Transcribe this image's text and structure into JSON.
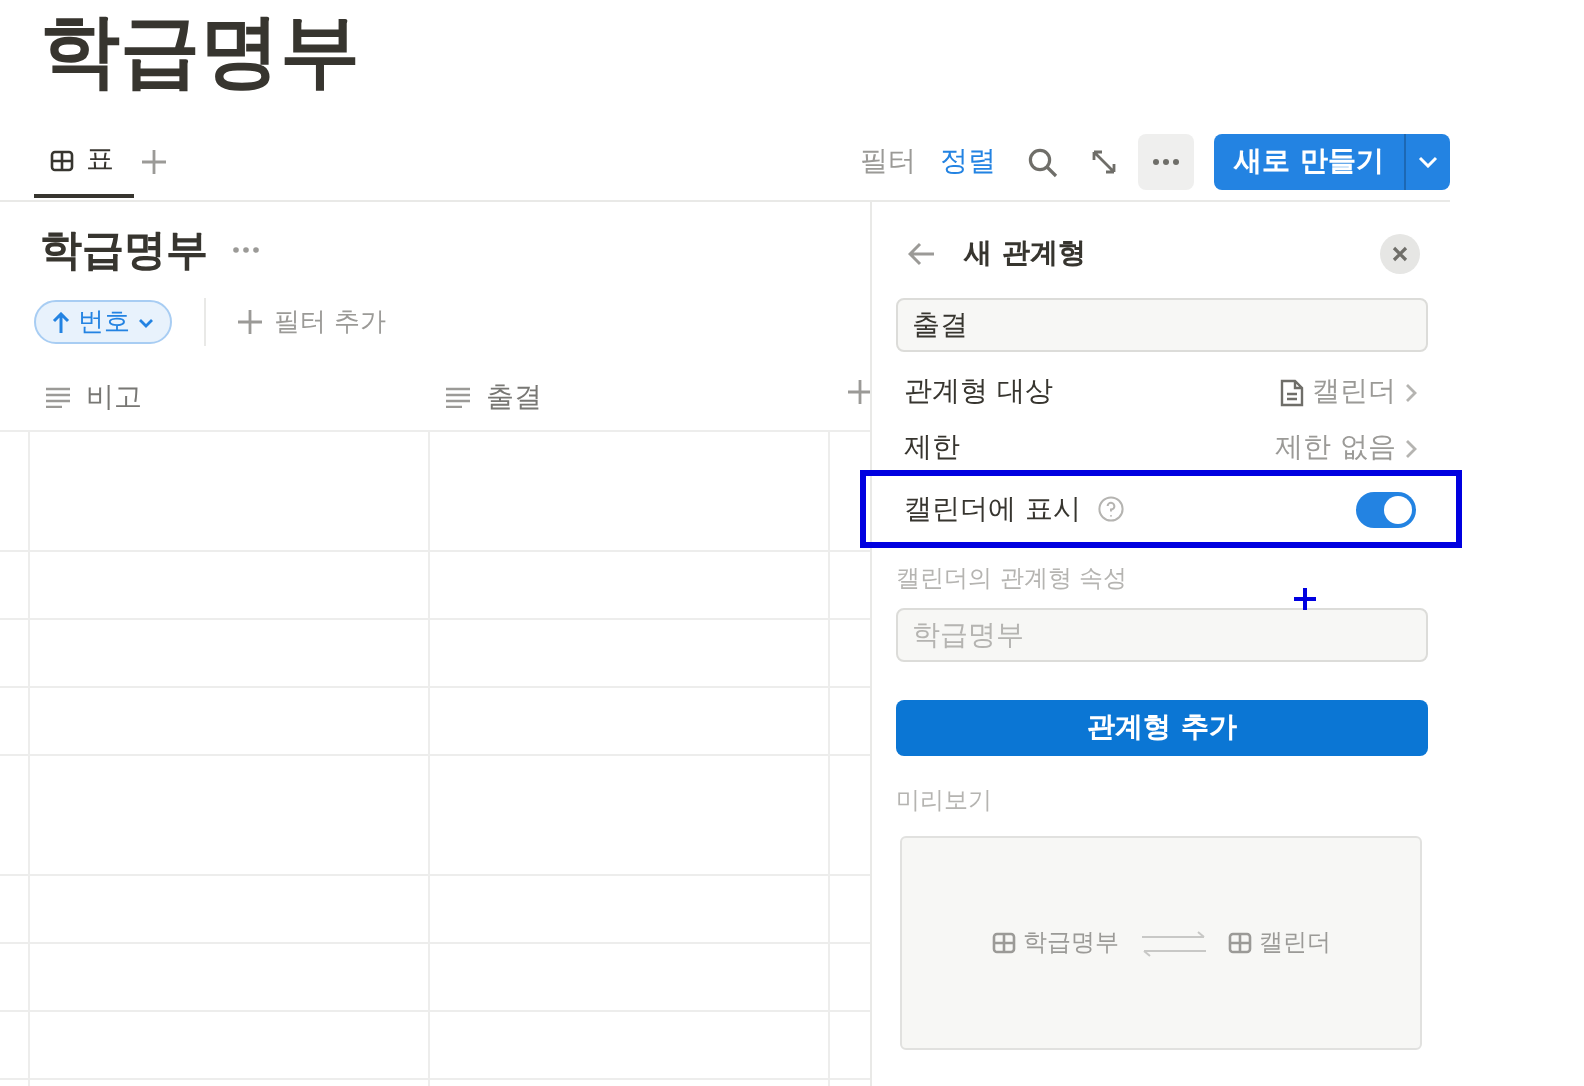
{
  "page_title": "학급명부",
  "tabs": [
    {
      "label": "표",
      "selected": true
    }
  ],
  "toolbar": {
    "filter": "필터",
    "sort": "정렬",
    "new_button": "새로 만들기"
  },
  "view": {
    "title": "학급명부",
    "sort_chip": "번호",
    "add_filter": "필터 추가"
  },
  "table": {
    "columns": [
      "비고",
      "출결"
    ]
  },
  "panel": {
    "title": "새 관계형",
    "name_value": "출결",
    "settings": [
      {
        "kind": "link",
        "label": "관계형 대상",
        "value": "캘린더",
        "highlighted": false
      },
      {
        "kind": "link",
        "label": "제한",
        "value": "제한 없음",
        "highlighted": false
      },
      {
        "kind": "toggle",
        "label": "캘린더에 표시",
        "on": true,
        "highlighted": true
      }
    ],
    "related_property": {
      "label": "캘린더의 관계형 속성",
      "placeholder": "학급명부"
    },
    "add_button": "관계형 추가",
    "preview": {
      "label": "미리보기",
      "source": "학급명부",
      "target": "캘린더"
    }
  }
}
